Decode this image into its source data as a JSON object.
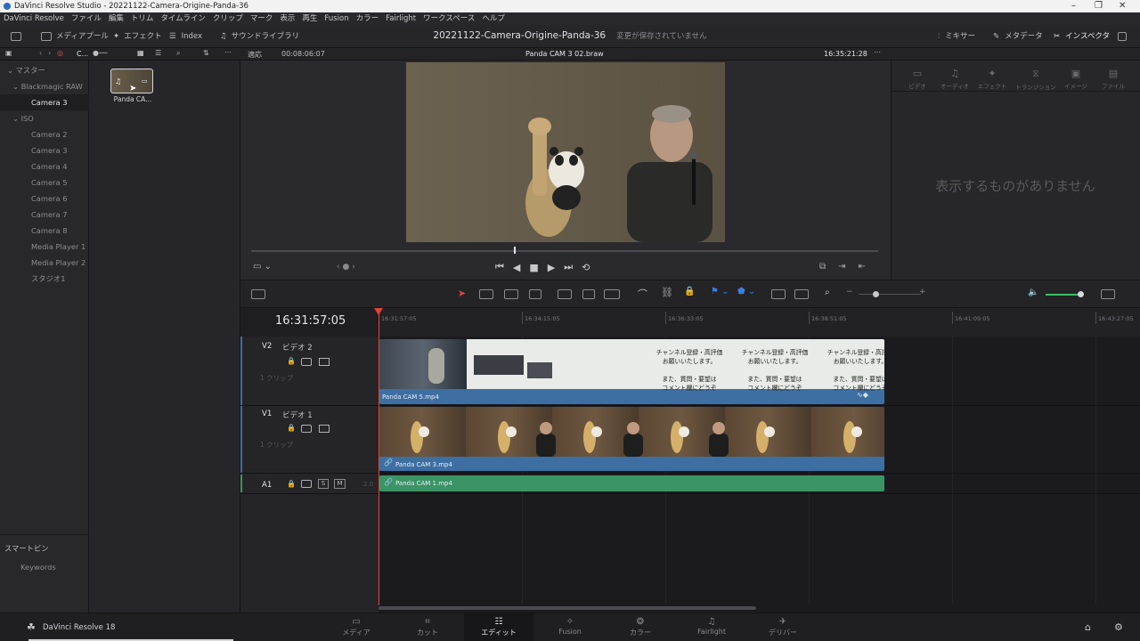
{
  "window": {
    "title": "DaVinci Resolve Studio - 20221122-Camera-Origine-Panda-36",
    "minimize": "–",
    "maximize": "❐",
    "close": "✕"
  },
  "menu": [
    "DaVinci Resolve",
    "ファイル",
    "編集",
    "トリム",
    "タイムライン",
    "クリップ",
    "マーク",
    "表示",
    "再生",
    "Fusion",
    "カラー",
    "Fairlight",
    "ワークスペース",
    "ヘルプ"
  ],
  "toolbar": {
    "media_pool": "メディアプール",
    "effects": "エフェクト",
    "index": "Index",
    "sound_library": "サウンドライブラリ",
    "project_name": "20221122-Camera-Origine-Panda-36",
    "save_status": "変更が保存されていません",
    "mixer": "ミキサー",
    "metadata": "メタデータ",
    "inspector": "インスペクタ"
  },
  "subbar": {
    "bin_short": "C...",
    "fit": "適応",
    "source_tc": "00:08:06:07",
    "clip_name": "Panda CAM 3 02.braw",
    "record_tc": "16:35:21:28"
  },
  "media_tree": {
    "root": "マスター",
    "items": [
      {
        "label": "Blackmagic RAW",
        "level": 1,
        "selected": false
      },
      {
        "label": "Camera 3",
        "level": 2,
        "selected": true
      },
      {
        "label": "ISO",
        "level": 1,
        "selected": false
      },
      {
        "label": "Camera 2",
        "level": 2,
        "selected": false
      },
      {
        "label": "Camera 3",
        "level": 2,
        "selected": false
      },
      {
        "label": "Camera 4",
        "level": 2,
        "selected": false
      },
      {
        "label": "Camera 5",
        "level": 2,
        "selected": false
      },
      {
        "label": "Camera 6",
        "level": 2,
        "selected": false
      },
      {
        "label": "Camera 7",
        "level": 2,
        "selected": false
      },
      {
        "label": "Camera 8",
        "level": 2,
        "selected": false
      },
      {
        "label": "Media Player 1",
        "level": 2,
        "selected": false
      },
      {
        "label": "Media Player 2",
        "level": 2,
        "selected": false
      },
      {
        "label": "スタジオ1",
        "level": 2,
        "selected": false
      }
    ],
    "smart_bins": "スマートビン",
    "keywords": "Keywords"
  },
  "bin_clip": {
    "name": "Panda CA..."
  },
  "inspector_panel": {
    "tabs": [
      "ビデオ",
      "オーディオ",
      "エフェクト",
      "トランジション",
      "イメージ",
      "ファイル"
    ],
    "empty_message": "表示するものがありません"
  },
  "timeline": {
    "timecode": "16:31:57:05",
    "ruler_ticks": [
      "16:31:57:05",
      "16:34:15:05",
      "16:36:33:05",
      "16:38:51:05",
      "16:41:09:05",
      "16:43:27:05"
    ],
    "tracks": [
      {
        "id": "V2",
        "name": "ビデオ 2",
        "clips_count": "1 クリップ",
        "clip": "Panda CAM 5.mp4"
      },
      {
        "id": "V1",
        "name": "ビデオ 1",
        "clips_count": "1 クリップ",
        "clip": "Panda CAM 3.mp4"
      },
      {
        "id": "A1",
        "name": "",
        "level": "2.0",
        "clip": "Panda CAM 1.mp4"
      }
    ],
    "v2_caption": [
      "チャンネル登録・高評価",
      "お願いいたします。",
      "また、質問・要望は",
      "コメント欄にどうぞ"
    ],
    "solo": "S",
    "mute": "M"
  },
  "pages": [
    {
      "label": "メディア",
      "active": false
    },
    {
      "label": "カット",
      "active": false
    },
    {
      "label": "エディット",
      "active": true
    },
    {
      "label": "Fusion",
      "active": false
    },
    {
      "label": "カラー",
      "active": false
    },
    {
      "label": "Fairlight",
      "active": false
    },
    {
      "label": "デリバー",
      "active": false
    }
  ],
  "brand": "DaVinci Resolve 18",
  "colors": {
    "video_clip": "#3d6fa3",
    "audio_clip": "#3b9465",
    "playhead": "#e0443a"
  }
}
